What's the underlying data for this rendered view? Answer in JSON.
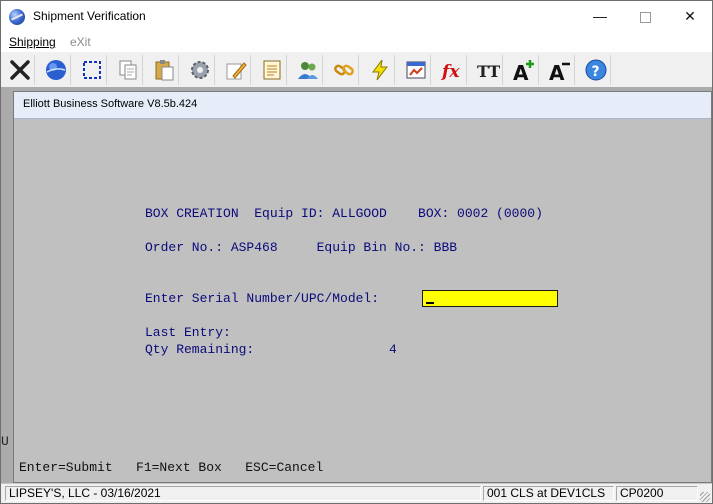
{
  "window": {
    "title": "Shipment Verification",
    "minimize": "—",
    "close": "✕"
  },
  "menu": {
    "shipping": "Shipping",
    "exit": "eXit"
  },
  "toolbar": {
    "icons": [
      "close-x-icon",
      "globe-icon",
      "select-rect-icon",
      "copy-icon",
      "paste-icon",
      "settings-gear-icon",
      "edit-pencil-icon",
      "notepad-icon",
      "users-icon",
      "link-chain-icon",
      "lightning-icon",
      "report-icon",
      "function-fx-icon",
      "font-size-icon",
      "font-increase-icon",
      "font-decrease-icon",
      "help-icon"
    ],
    "fx_label": "fx",
    "tt_label": "TT",
    "font_a": "A",
    "help_q": "?"
  },
  "child_window": {
    "title": "Elliott Business Software V8.5b.424"
  },
  "terminal": {
    "box_creation_line": "BOX CREATION  Equip ID: ALLGOOD    BOX: 0002 (0000)",
    "order_line": "Order No.: ASP468     Equip Bin No.: BBB",
    "prompt": "Enter Serial Number/UPC/Model:",
    "input_value": "",
    "last_entry_label": "Last Entry:",
    "last_entry_value": "",
    "qty_remaining_label": "Qty Remaining:",
    "qty_remaining_value": "4",
    "footer": "Enter=Submit   F1=Next Box   ESC=Cancel",
    "left_mark": "U"
  },
  "status": {
    "company": "LIPSEY'S, LLC - 03/16/2021",
    "session": "001 CLS at DEV1CLS",
    "program": "CP0200"
  }
}
